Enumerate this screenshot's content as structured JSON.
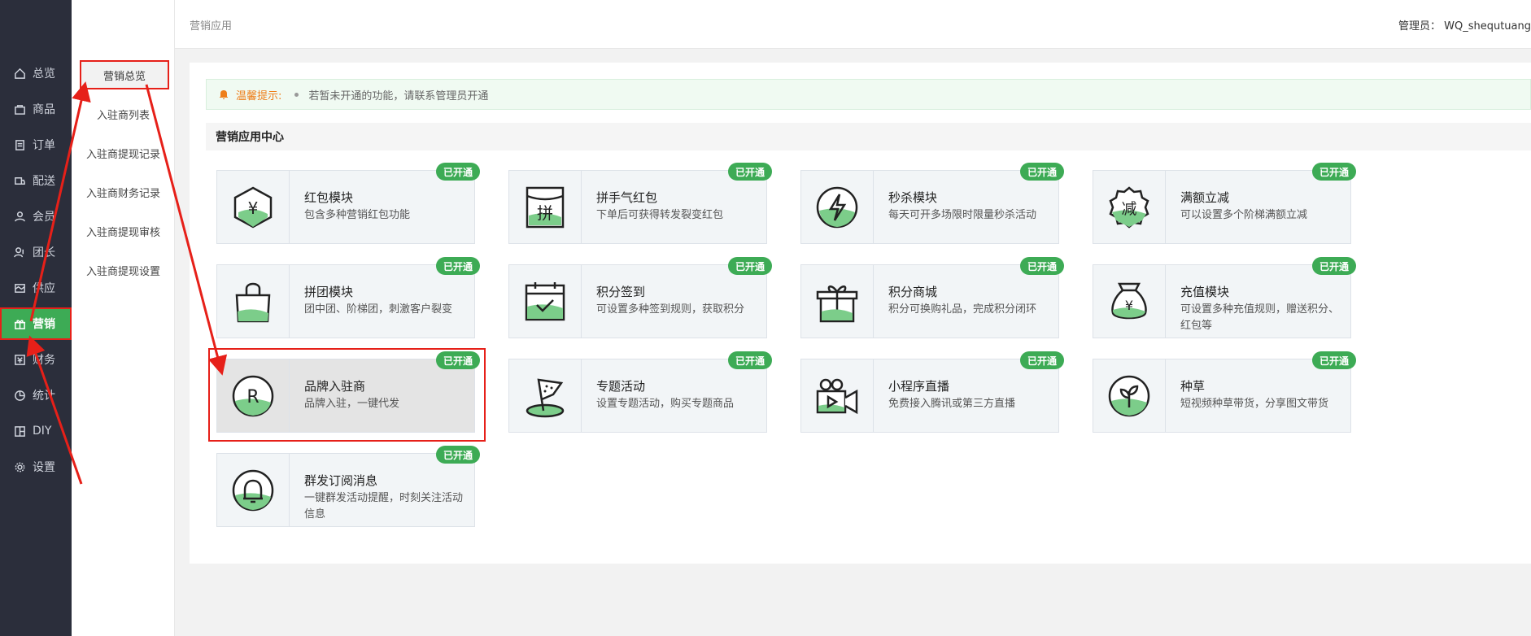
{
  "nav": {
    "items": [
      {
        "label": "总览",
        "icon": "home-icon"
      },
      {
        "label": "商品",
        "icon": "bag-icon"
      },
      {
        "label": "订单",
        "icon": "order-icon"
      },
      {
        "label": "配送",
        "icon": "delivery-icon"
      },
      {
        "label": "会员",
        "icon": "user-icon"
      },
      {
        "label": "团长",
        "icon": "leader-icon"
      },
      {
        "label": "供应",
        "icon": "supply-icon"
      },
      {
        "label": "营销",
        "icon": "gift-icon",
        "active": true
      },
      {
        "label": "财务",
        "icon": "finance-icon"
      },
      {
        "label": "统计",
        "icon": "stats-icon"
      },
      {
        "label": "DIY",
        "icon": "diy-icon"
      },
      {
        "label": "设置",
        "icon": "gear-icon"
      }
    ]
  },
  "subnav": {
    "items": [
      {
        "label": "营销总览",
        "active": true
      },
      {
        "label": "入驻商列表"
      },
      {
        "label": "入驻商提现记录"
      },
      {
        "label": "入驻商财务记录"
      },
      {
        "label": "入驻商提现审核"
      },
      {
        "label": "入驻商提现设置"
      }
    ]
  },
  "header": {
    "breadcrumb": "营销应用",
    "admin_label": "管理员：",
    "admin_name": "WQ_shequtuang"
  },
  "notice": {
    "label": "温馨提示:",
    "text": "若暂未开通的功能，请联系管理员开通"
  },
  "section": {
    "title": "营销应用中心"
  },
  "badge_text": "已开通",
  "colors": {
    "accent": "#3dab55",
    "nav_bg": "#2b2e3b",
    "annotation": "#e62019",
    "tip": "#ee7f1b"
  },
  "cards": [
    {
      "name": "红包模块",
      "desc": "包含多种营销红包功能",
      "icon": "red-packet-icon"
    },
    {
      "name": "拼手气红包",
      "desc": "下单后可获得转发裂变红包",
      "icon": "pin-icon"
    },
    {
      "name": "秒杀模块",
      "desc": "每天可开多场限时限量秒杀活动",
      "icon": "lightning-icon"
    },
    {
      "name": "满额立减",
      "desc": "可以设置多个阶梯满额立减",
      "icon": "discount-icon"
    },
    {
      "name": "拼团模块",
      "desc": "团中团、阶梯团，刺激客户裂变",
      "icon": "shopping-bag-icon"
    },
    {
      "name": "积分签到",
      "desc": "可设置多种签到规则，获取积分",
      "icon": "calendar-check-icon"
    },
    {
      "name": "积分商城",
      "desc": "积分可换购礼品，完成积分闭环",
      "icon": "gift-box-icon"
    },
    {
      "name": "充值模块",
      "desc": "可设置多种充值规则，赠送积分、红包等",
      "icon": "money-bag-icon"
    },
    {
      "name": "品牌入驻商",
      "desc": "品牌入驻，一键代发",
      "icon": "registered-icon",
      "selected": true
    },
    {
      "name": "专题活动",
      "desc": "设置专题活动，购买专题商品",
      "icon": "flag-icon"
    },
    {
      "name": "小程序直播",
      "desc": "免费接入腾讯或第三方直播",
      "icon": "video-camera-icon"
    },
    {
      "name": "种草",
      "desc": "短视频种草带货，分享图文带货",
      "icon": "sprout-icon"
    },
    {
      "name": "群发订阅消息",
      "desc": "一键群发活动提醒，时刻关注活动信息",
      "icon": "bell-icon"
    }
  ]
}
